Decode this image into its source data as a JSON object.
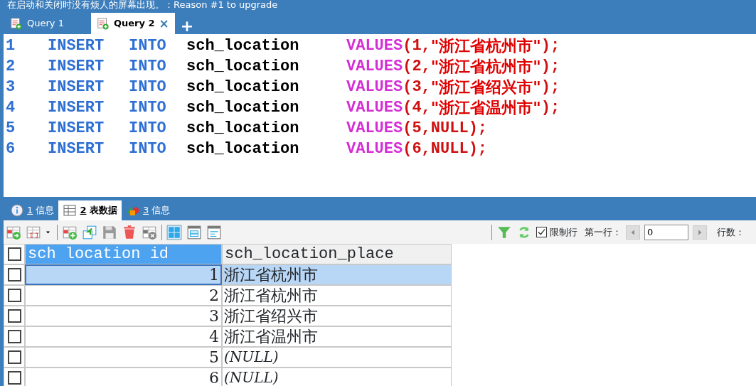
{
  "banner": {
    "text": "在启动和关闭时没有烦人的屏幕出现。：Reason #1 to upgrade"
  },
  "query_tabs": [
    {
      "label": "Query 1",
      "selected": false
    },
    {
      "label": "Query 2",
      "selected": true,
      "close": "×"
    }
  ],
  "add_tab": "+",
  "editor": {
    "lines": [
      {
        "number": "1",
        "tokens": [
          {
            "kind": "keyword",
            "text": "INSERT"
          },
          {
            "kind": "keyword",
            "text": "INTO"
          },
          {
            "kind": "ident",
            "text": "sch_location"
          },
          {
            "kind": "func",
            "text": "VALUES"
          },
          {
            "kind": "punct",
            "text": "(1,"
          },
          {
            "kind": "string",
            "text": "\"浙江省杭州市\""
          },
          {
            "kind": "punct",
            "text": ");"
          }
        ]
      },
      {
        "number": "2",
        "tokens": [
          {
            "kind": "keyword",
            "text": "INSERT"
          },
          {
            "kind": "keyword",
            "text": "INTO"
          },
          {
            "kind": "ident",
            "text": "sch_location"
          },
          {
            "kind": "func",
            "text": "VALUES"
          },
          {
            "kind": "punct",
            "text": "(2,"
          },
          {
            "kind": "string",
            "text": "\"浙江省杭州市\""
          },
          {
            "kind": "punct",
            "text": ");"
          }
        ]
      },
      {
        "number": "3",
        "tokens": [
          {
            "kind": "keyword",
            "text": "INSERT"
          },
          {
            "kind": "keyword",
            "text": "INTO"
          },
          {
            "kind": "ident",
            "text": "sch_location"
          },
          {
            "kind": "func",
            "text": "VALUES"
          },
          {
            "kind": "punct",
            "text": "(3,"
          },
          {
            "kind": "string",
            "text": "\"浙江省绍兴市\""
          },
          {
            "kind": "punct",
            "text": ");"
          }
        ]
      },
      {
        "number": "4",
        "tokens": [
          {
            "kind": "keyword",
            "text": "INSERT"
          },
          {
            "kind": "keyword",
            "text": "INTO"
          },
          {
            "kind": "ident",
            "text": "sch_location"
          },
          {
            "kind": "func",
            "text": "VALUES"
          },
          {
            "kind": "punct",
            "text": "(4,"
          },
          {
            "kind": "string",
            "text": "\"浙江省温州市\""
          },
          {
            "kind": "punct",
            "text": ");"
          }
        ]
      },
      {
        "number": "5",
        "tokens": [
          {
            "kind": "keyword",
            "text": "INSERT"
          },
          {
            "kind": "keyword",
            "text": "INTO"
          },
          {
            "kind": "ident",
            "text": "sch_location"
          },
          {
            "kind": "func",
            "text": "VALUES"
          },
          {
            "kind": "punct",
            "text": "(5,NULL);"
          }
        ]
      },
      {
        "number": "6",
        "tokens": [
          {
            "kind": "keyword",
            "text": "INSERT"
          },
          {
            "kind": "keyword",
            "text": "INTO"
          },
          {
            "kind": "ident",
            "text": "sch_location"
          },
          {
            "kind": "func",
            "text": "VALUES"
          },
          {
            "kind": "punct",
            "text": "(6,NULL);"
          }
        ]
      }
    ]
  },
  "result_tabs": [
    {
      "kind": "info",
      "number": "1",
      "label": "信息",
      "selected": false
    },
    {
      "kind": "table",
      "number": "2",
      "label": "表数据",
      "selected": true
    },
    {
      "kind": "shapes",
      "number": "3",
      "label": "信息",
      "selected": false
    }
  ],
  "toolbar": {
    "limit_rows": {
      "label": "限制行",
      "checked": true
    },
    "first_row_label": "第一行：",
    "first_row_value": "0",
    "row_count_label": "行数："
  },
  "table": {
    "select_all_checked": false,
    "columns": [
      {
        "label": "sch location id",
        "selected": true
      },
      {
        "label": "sch_location_place",
        "selected": false
      }
    ],
    "rows": [
      {
        "id": "1",
        "place": "浙江省杭州市",
        "null": false,
        "selected": true,
        "checked": false
      },
      {
        "id": "2",
        "place": "浙江省杭州市",
        "null": false,
        "selected": false,
        "checked": false
      },
      {
        "id": "3",
        "place": "浙江省绍兴市",
        "null": false,
        "selected": false,
        "checked": false
      },
      {
        "id": "4",
        "place": "浙江省温州市",
        "null": false,
        "selected": false,
        "checked": false
      },
      {
        "id": "5",
        "place": "(NULL)",
        "null": true,
        "selected": false,
        "checked": false
      },
      {
        "id": "6",
        "place": "(NULL)",
        "null": true,
        "selected": false,
        "checked": false
      }
    ]
  }
}
